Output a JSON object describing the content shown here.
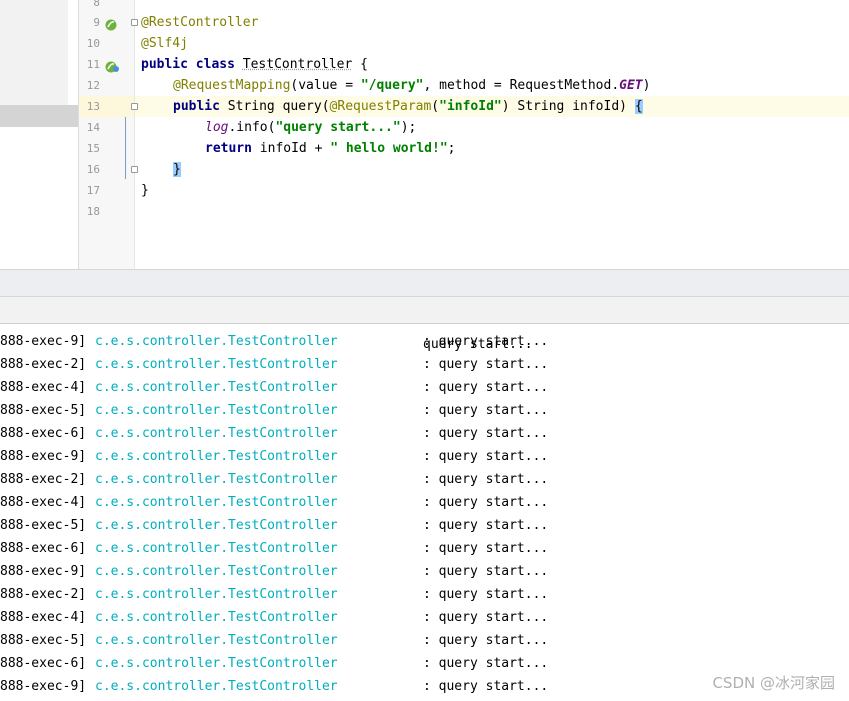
{
  "editor": {
    "line_numbers": [
      "8",
      "9",
      "10",
      "11",
      "12",
      "13",
      "14",
      "15",
      "16",
      "17",
      "18"
    ],
    "line9": {
      "annotation": "@RestController"
    },
    "line10": {
      "annotation": "@Slf4j"
    },
    "line11": {
      "kw1": "public",
      "kw2": "class",
      "name": "TestController",
      "rest": " {"
    },
    "line12": {
      "annotation": "@RequestMapping",
      "p1": "(value = ",
      "str": "\"/query\"",
      "p2": ", method = RequestMethod.",
      "field": "GET",
      "p3": ")"
    },
    "line13": {
      "kw": "public",
      "p1": " String query(",
      "annotation": "@RequestParam",
      "p2": "(",
      "str": "\"infoId\"",
      "p3": ") String infoId) ",
      "brace": "{"
    },
    "line14": {
      "log": "log",
      "p1": ".info(",
      "str": "\"query start...\"",
      "p2": ");"
    },
    "line15": {
      "kw": "return",
      "p1": " infoId + ",
      "str": "\" hello world!\"",
      "p2": ";"
    },
    "line16": {
      "brace": "}"
    },
    "line17": {
      "brace": "}"
    }
  },
  "console": {
    "logger": "c.e.s.controller.TestController",
    "separator": ":",
    "message": "query start...",
    "partial_row_thread": "",
    "rows": [
      {
        "thread": "888-exec-9]"
      },
      {
        "thread": "888-exec-2]"
      },
      {
        "thread": "888-exec-4]"
      },
      {
        "thread": "888-exec-5]"
      },
      {
        "thread": "888-exec-6]"
      },
      {
        "thread": "888-exec-9]"
      },
      {
        "thread": "888-exec-2]"
      },
      {
        "thread": "888-exec-4]"
      },
      {
        "thread": "888-exec-5]"
      },
      {
        "thread": "888-exec-6]"
      },
      {
        "thread": "888-exec-9]"
      },
      {
        "thread": "888-exec-2]"
      },
      {
        "thread": "888-exec-4]"
      },
      {
        "thread": "888-exec-5]"
      },
      {
        "thread": "888-exec-6]"
      },
      {
        "thread": "888-exec-9]"
      }
    ]
  },
  "watermark": "CSDN @冰河家园",
  "colors": {
    "logger": "#00aebd",
    "annotation": "#808000",
    "keyword": "#000080",
    "string": "#008000",
    "caret_line": "#fefbe6"
  }
}
